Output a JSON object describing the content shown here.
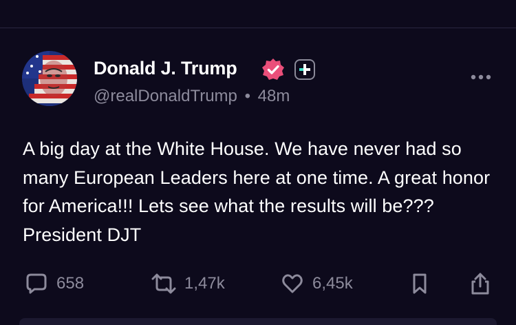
{
  "post": {
    "author": {
      "display_name": "Donald J. Trump",
      "handle": "@realDonaldTrump",
      "separator": "•",
      "time": "48m",
      "verified_icon": "verified-badge-icon",
      "extra_icon": "plus-icon"
    },
    "text": "A big day at the White House. We have never had so many European Leaders here at one time. A great honor for America!!! Lets see what the results will be??? President DJT",
    "actions": {
      "replies": "658",
      "reposts": "1,47k",
      "likes": "6,45k"
    }
  },
  "colors": {
    "background": "#0d0a1c",
    "text": "#ffffff",
    "muted": "#8d8b9c",
    "verified": "#ea4f7a",
    "plus_accent": "#3fe0c8"
  }
}
